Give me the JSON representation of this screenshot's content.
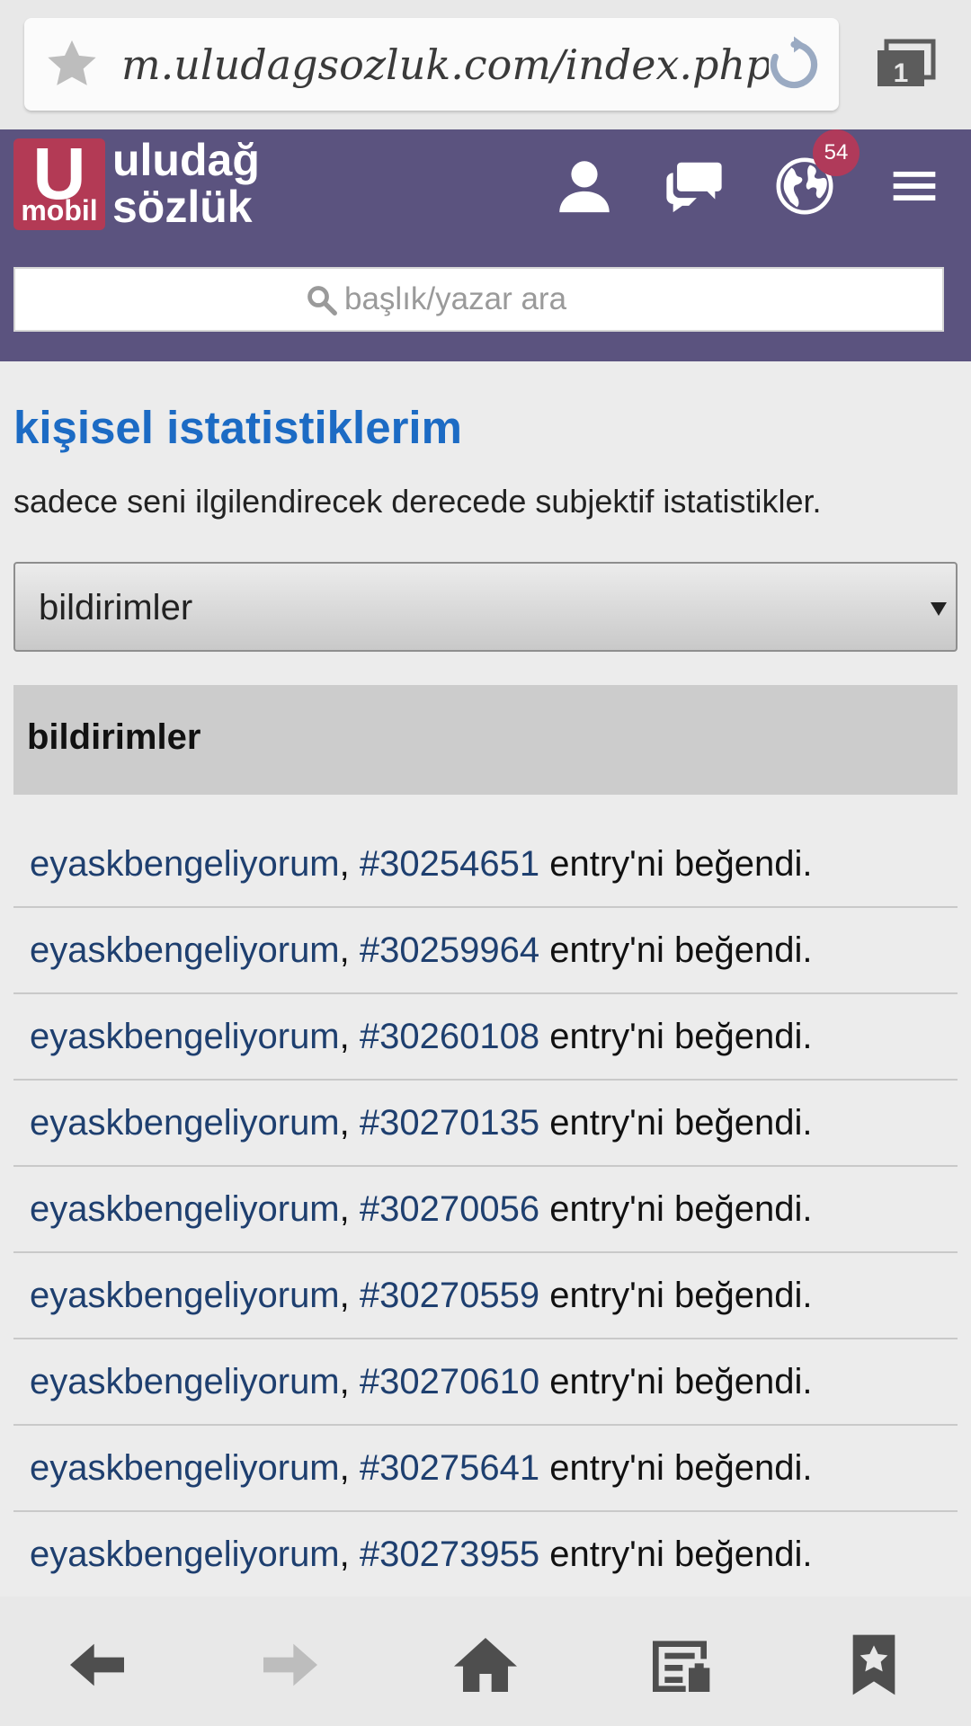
{
  "browser": {
    "url": "m.uludagsozluk.com/index.php",
    "tabs_count": "1"
  },
  "header": {
    "logo": {
      "letter": "U",
      "sub": "mobil",
      "name": "uludağ sözlük"
    },
    "notification_count": "54",
    "search_placeholder": "başlık/yazar ara"
  },
  "main": {
    "title": "kişisel istatistiklerim",
    "description": "sadece seni ilgilendirecek derecede subjektif istatistikler.",
    "select_value": "bildirimler",
    "panel_title": "bildirimler",
    "notifications": [
      {
        "user": "eyaskbengeliyorum",
        "sep": ", ",
        "entry": "#30254651",
        "text": " entry'ni beğendi."
      },
      {
        "user": "eyaskbengeliyorum",
        "sep": ", ",
        "entry": "#30259964",
        "text": " entry'ni beğendi."
      },
      {
        "user": "eyaskbengeliyorum",
        "sep": ", ",
        "entry": "#30260108",
        "text": " entry'ni beğendi."
      },
      {
        "user": "eyaskbengeliyorum",
        "sep": ", ",
        "entry": "#30270135",
        "text": " entry'ni beğendi."
      },
      {
        "user": "eyaskbengeliyorum",
        "sep": ", ",
        "entry": "#30270056",
        "text": " entry'ni beğendi."
      },
      {
        "user": "eyaskbengeliyorum",
        "sep": ", ",
        "entry": "#30270559",
        "text": " entry'ni beğendi."
      },
      {
        "user": "eyaskbengeliyorum",
        "sep": ", ",
        "entry": "#30270610",
        "text": " entry'ni beğendi."
      },
      {
        "user": "eyaskbengeliyorum",
        "sep": ", ",
        "entry": "#30275641",
        "text": " entry'ni beğendi."
      },
      {
        "user": "eyaskbengeliyorum",
        "sep": ", ",
        "entry": "#30273955",
        "text": " entry'ni beğendi."
      }
    ]
  },
  "icons": {
    "star": "star-icon",
    "reload": "reload-icon",
    "tabs": "tabs-icon",
    "profile": "user-icon",
    "messages": "chat-icon",
    "activity": "globe-icon",
    "menu": "hamburger-icon",
    "search": "search-icon",
    "back": "back-arrow-icon",
    "forward": "forward-arrow-icon",
    "home": "home-icon",
    "reader": "reader-icon",
    "bookmarks": "bookmark-icon"
  },
  "colors": {
    "header_bg": "#5b537f",
    "logo_bg": "#b33a55",
    "title": "#1c6bc4",
    "link": "#1e3f6f",
    "badge": "#b03a5a"
  }
}
